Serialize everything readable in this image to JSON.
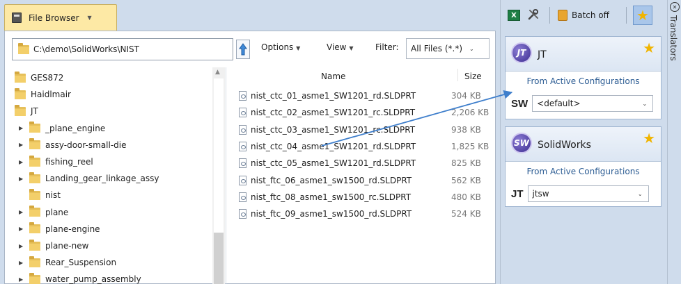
{
  "tab": {
    "label": "File Browser"
  },
  "toolbar": {
    "path": "C:\\demo\\SolidWorks\\NIST",
    "options_label": "Options",
    "view_label": "View",
    "filter_label": "Filter:",
    "filter_value": "All Files (*.*)"
  },
  "tree": {
    "items": [
      {
        "label": "GES872",
        "level": 0,
        "expandable": false
      },
      {
        "label": "Haidlmair",
        "level": 0,
        "expandable": false
      },
      {
        "label": "JT",
        "level": 0,
        "expandable": false
      },
      {
        "label": "_plane_engine",
        "level": 1,
        "expandable": true
      },
      {
        "label": "assy-door-small-die",
        "level": 1,
        "expandable": true
      },
      {
        "label": "fishing_reel",
        "level": 1,
        "expandable": true
      },
      {
        "label": "Landing_gear_linkage_assy",
        "level": 1,
        "expandable": true
      },
      {
        "label": "nist",
        "level": 1,
        "expandable": false
      },
      {
        "label": "plane",
        "level": 1,
        "expandable": true
      },
      {
        "label": "plane-engine",
        "level": 1,
        "expandable": true
      },
      {
        "label": "plane-new",
        "level": 1,
        "expandable": true
      },
      {
        "label": "Rear_Suspension",
        "level": 1,
        "expandable": true
      },
      {
        "label": "water_pump_assembly",
        "level": 1,
        "expandable": true
      }
    ]
  },
  "files": {
    "header_name": "Name",
    "header_size": "Size",
    "rows": [
      {
        "name": "nist_ctc_01_asme1_SW1201_rd.SLDPRT",
        "size": "304 KB"
      },
      {
        "name": "nist_ctc_02_asme1_SW1201_rc.SLDPRT",
        "size": "2,206 KB"
      },
      {
        "name": "nist_ctc_03_asme1_SW1201_rc.SLDPRT",
        "size": "938 KB"
      },
      {
        "name": "nist_ctc_04_asme1_SW1201_rd.SLDPRT",
        "size": "1,825 KB"
      },
      {
        "name": "nist_ctc_05_asme1_SW1201_rd.SLDPRT",
        "size": "825 KB"
      },
      {
        "name": "nist_ftc_06_asme1_sw1500_rd.SLDPRT",
        "size": "562 KB"
      },
      {
        "name": "nist_ftc_08_asme1_sw1500_rc.SLDPRT",
        "size": "480 KB"
      },
      {
        "name": "nist_ftc_09_asme1_sw1500_rd.SLDPRT",
        "size": "524 KB"
      }
    ]
  },
  "right_toolbar": {
    "batch_label": "Batch off"
  },
  "jt_card": {
    "badge": "JT",
    "title": "JT",
    "subtitle": "From Active Configurations",
    "prefix": "SW",
    "value": "<default>"
  },
  "sw_card": {
    "badge": "SW",
    "title": "SolidWorks",
    "subtitle": "From Active Configurations",
    "prefix": "JT",
    "value": "jtsw"
  },
  "side_panel": {
    "label": "Translators"
  },
  "colors": {
    "accent": "#3f7fcc",
    "tab": "#fde9a5",
    "star": "#f0b400"
  }
}
